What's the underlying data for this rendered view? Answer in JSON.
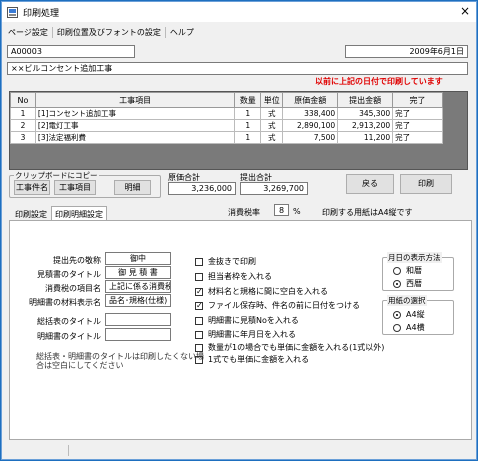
{
  "window": {
    "title": "印刷処理",
    "close": "×"
  },
  "menu": [
    "ページ設定",
    "印刷位置及びフォントの設定",
    "ヘルプ"
  ],
  "header": {
    "code": "A00003",
    "date": "2009年6月1日",
    "project_name": "××ビルコンセント追加工事",
    "date_warning": "以前に上記の日付で印刷しています"
  },
  "table": {
    "columns": [
      "No",
      "工事項目",
      "数量",
      "単位",
      "原価金額",
      "提出金額",
      "完了"
    ],
    "rows": [
      [
        "1",
        "[1]コンセント追加工事",
        "1",
        "式",
        "338,400",
        "345,300",
        "完了"
      ],
      [
        "2",
        "[2]電灯工事",
        "1",
        "式",
        "2,890,100",
        "2,913,200",
        "完了"
      ],
      [
        "3",
        "[3]法定福利費",
        "1",
        "式",
        "7,500",
        "11,200",
        "完了"
      ]
    ]
  },
  "clipboard": {
    "group_label": "クリップボードにコピー",
    "btn_project": "工事件名",
    "btn_item": "工事項目",
    "btn_detail": "明細"
  },
  "totals": {
    "cost_label": "原価合計",
    "cost_value": "3,236,000",
    "submit_label": "提出合計",
    "submit_value": "3,269,700"
  },
  "actions": {
    "back": "戻る",
    "print": "印刷"
  },
  "tabs": [
    "印刷設定",
    "印刷明細設定"
  ],
  "tax": {
    "label": "消費税率",
    "value": "8",
    "unit": "%"
  },
  "paper_note": "印刷する用紙はA4縦です",
  "fields": [
    {
      "label": "提出先の敬称",
      "value": "御中"
    },
    {
      "label": "見積書のタイトル",
      "value": "御 見 積 書"
    },
    {
      "label": "消費税の項目名",
      "value": "上記に係る消費税"
    },
    {
      "label": "明細書の材料表示名",
      "value": "品名･規格(仕様)"
    },
    {
      "label": "総括表のタイトル",
      "value": ""
    },
    {
      "label": "明細書のタイトル",
      "value": ""
    }
  ],
  "hint": "総括表・明細書のタイトルは印刷したくない場合は空白にしてください",
  "checkboxes": [
    {
      "label": "金抜きで印刷",
      "checked": false
    },
    {
      "label": "担当者枠を入れる",
      "checked": false
    },
    {
      "label": "材料名と規格に間に空白を入れる",
      "checked": true
    },
    {
      "label": "ファイル保存時、件名の前に日付をつける",
      "checked": true
    },
    {
      "label": "明細書に見積Noを入れる",
      "checked": false
    },
    {
      "label": "明細書に年月日を入れる",
      "checked": false
    },
    {
      "label": "数量が1の場合でも単価に金額を入れる(1式以外)",
      "checked": false
    },
    {
      "label": "1式でも単価に金額を入れる",
      "checked": false
    }
  ],
  "date_display": {
    "label": "月日の表示方法",
    "options": [
      {
        "label": "和暦",
        "selected": false
      },
      {
        "label": "西暦",
        "selected": true
      }
    ]
  },
  "paper_select": {
    "label": "用紙の選択",
    "options": [
      {
        "label": "A4縦",
        "selected": true
      },
      {
        "label": "A4横",
        "selected": false
      }
    ]
  }
}
